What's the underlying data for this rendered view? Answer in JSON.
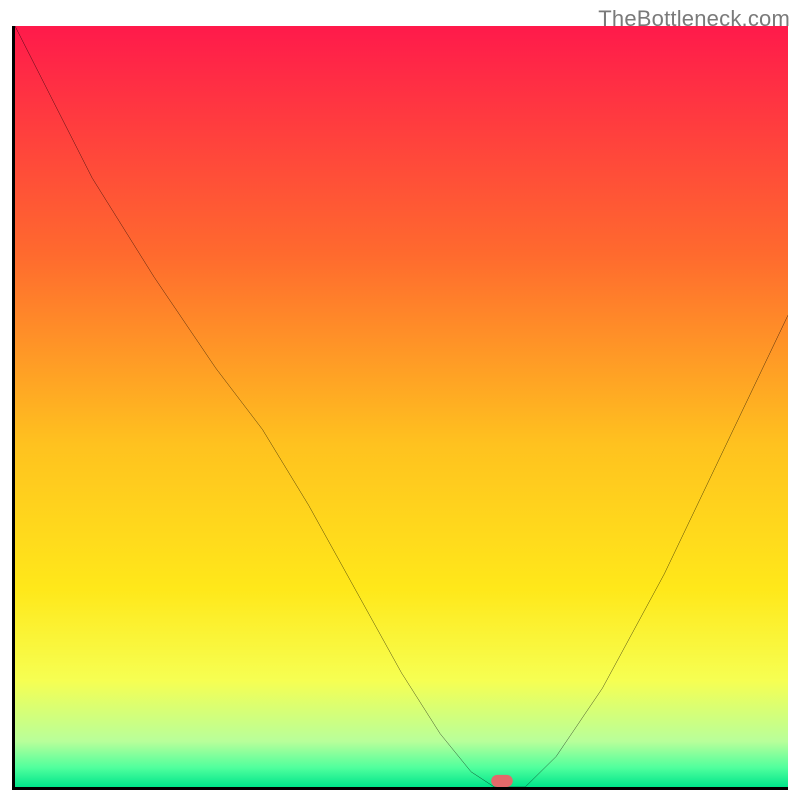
{
  "attribution": "TheBottleneck.com",
  "chart_data": {
    "type": "line",
    "title": "",
    "xlabel": "",
    "ylabel": "",
    "xlim": [
      0,
      100
    ],
    "ylim": [
      0,
      100
    ],
    "grid": false,
    "legend": false,
    "gradient_stops": [
      {
        "offset": 0,
        "color": "#ff1a4b"
      },
      {
        "offset": 0.3,
        "color": "#ff6a2e"
      },
      {
        "offset": 0.55,
        "color": "#ffc21f"
      },
      {
        "offset": 0.74,
        "color": "#ffe81a"
      },
      {
        "offset": 0.86,
        "color": "#f6ff52"
      },
      {
        "offset": 0.94,
        "color": "#b8ff9a"
      },
      {
        "offset": 0.975,
        "color": "#4fff9d"
      },
      {
        "offset": 1.0,
        "color": "#00e58b"
      }
    ],
    "x": [
      0,
      4,
      10,
      18,
      26,
      32,
      38,
      44,
      50,
      55,
      59,
      62,
      64,
      66,
      70,
      76,
      84,
      92,
      100
    ],
    "values": [
      100,
      92,
      80,
      67,
      55,
      47,
      37,
      26,
      15,
      7,
      2,
      0,
      0,
      0,
      4,
      13,
      28,
      45,
      62
    ],
    "minimum_marker": {
      "x": 63,
      "y": 0,
      "width": 2.8,
      "height": 1.6,
      "color": "#e26a6a"
    },
    "annotations": []
  }
}
